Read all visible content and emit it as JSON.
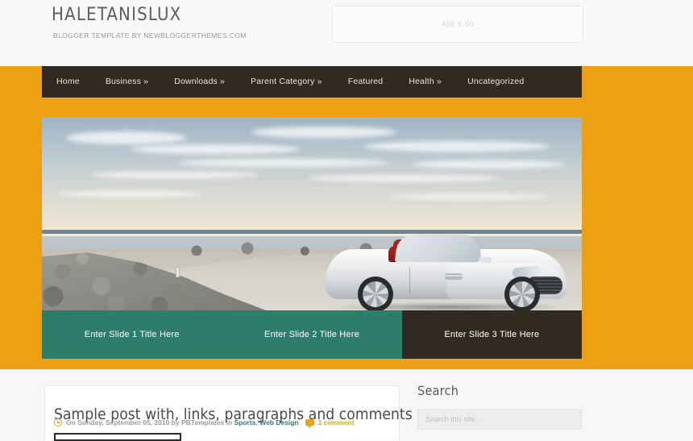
{
  "header": {
    "site_title": "HALETANISLUX",
    "tagline": "BLOGGER TEMPLATE BY NEWBLOGGERTHEMES.COM",
    "ad_placeholder": "468 X 60"
  },
  "nav": {
    "items": [
      {
        "label": "Home"
      },
      {
        "label": "Business »"
      },
      {
        "label": "Downloads »"
      },
      {
        "label": "Parent Category »"
      },
      {
        "label": "Featured"
      },
      {
        "label": "Health »"
      },
      {
        "label": "Uncategorized"
      }
    ]
  },
  "slider": {
    "image_alt": "Silver convertible sports car parked on a coastal road beside rocks and sea",
    "tabs": [
      {
        "label": "Enter Slide 1 Title Here",
        "state": "active"
      },
      {
        "label": "Enter Slide 2 Title Here",
        "state": "active"
      },
      {
        "label": "Enter Slide 3 Title Here",
        "state": "inactive"
      }
    ]
  },
  "post": {
    "title": "Sample post with, links, paragraphs and comments",
    "meta_prefix": "On Sunday, September 05, 2010 by PBTemplates in",
    "categories": [
      {
        "label": "Sports"
      },
      {
        "label": "Web Design"
      }
    ],
    "category_separator": ",",
    "comment_count": "1 comment"
  },
  "sidebar": {
    "search_widget_title": "Search",
    "search_placeholder": "Search this site..."
  },
  "colors": {
    "orange": "#eda013",
    "dark_brown": "#302a20",
    "teal": "#2e7d6b",
    "body_bg": "#f7f7f7",
    "link_green": "#2e7d6b",
    "accent_yellow": "#e8a317"
  }
}
